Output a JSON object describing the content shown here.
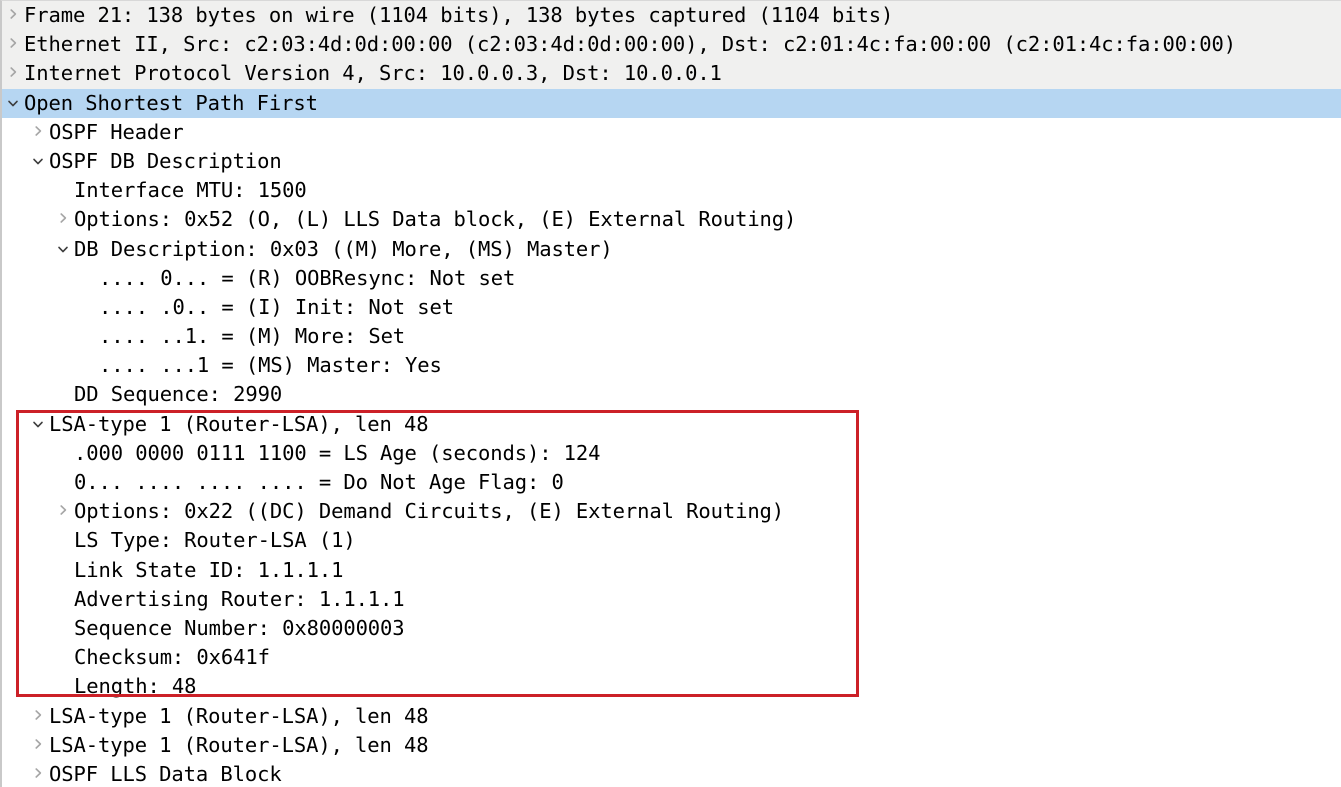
{
  "pane": {
    "name": "wireshark-packet-details",
    "selected_row_index": 3,
    "colors": {
      "selection": "#b6d6f2",
      "shaded_row": "#f0f0ef",
      "annotation_box": "#cc2027",
      "collapsed_arrow": "#a6a6a6",
      "expanded_arrow": "#3c3c3c",
      "text": "#000000"
    }
  },
  "annotation": {
    "shape": "rectangle",
    "color": "#cc2027",
    "covers_rows": [
      12,
      13,
      14,
      15,
      16,
      17,
      18,
      19,
      20,
      21
    ]
  },
  "rows": [
    {
      "text": "Frame 21: 138 bytes on wire (1104 bits), 138 bytes captured (1104 bits)",
      "indent": 0,
      "state": "collapsed",
      "shaded": true,
      "selected": false
    },
    {
      "text": "Ethernet II, Src: c2:03:4d:0d:00:00 (c2:03:4d:0d:00:00), Dst: c2:01:4c:fa:00:00 (c2:01:4c:fa:00:00)",
      "indent": 0,
      "state": "collapsed",
      "shaded": true,
      "selected": false
    },
    {
      "text": "Internet Protocol Version 4, Src: 10.0.0.3, Dst: 10.0.0.1",
      "indent": 0,
      "state": "collapsed",
      "shaded": true,
      "selected": false
    },
    {
      "text": "Open Shortest Path First",
      "indent": 0,
      "state": "expanded",
      "shaded": false,
      "selected": true
    },
    {
      "text": "OSPF Header",
      "indent": 1,
      "state": "collapsed",
      "shaded": false,
      "selected": false
    },
    {
      "text": "OSPF DB Description",
      "indent": 1,
      "state": "expanded",
      "shaded": false,
      "selected": false
    },
    {
      "text": "Interface MTU: 1500",
      "indent": 2,
      "state": "leaf",
      "shaded": false,
      "selected": false
    },
    {
      "text": "Options: 0x52 (O, (L) LLS Data block, (E) External Routing)",
      "indent": 2,
      "state": "collapsed",
      "shaded": false,
      "selected": false
    },
    {
      "text": "DB Description: 0x03 ((M) More, (MS) Master)",
      "indent": 2,
      "state": "expanded",
      "shaded": false,
      "selected": false
    },
    {
      "text": ".... 0... = (R) OOBResync: Not set",
      "indent": 3,
      "state": "leaf",
      "shaded": false,
      "selected": false
    },
    {
      "text": ".... .0.. = (I) Init: Not set",
      "indent": 3,
      "state": "leaf",
      "shaded": false,
      "selected": false
    },
    {
      "text": ".... ..1. = (M) More: Set",
      "indent": 3,
      "state": "leaf",
      "shaded": false,
      "selected": false
    },
    {
      "text": ".... ...1 = (MS) Master: Yes",
      "indent": 3,
      "state": "leaf",
      "shaded": false,
      "selected": false
    },
    {
      "text": "DD Sequence: 2990",
      "indent": 2,
      "state": "leaf",
      "shaded": false,
      "selected": false
    },
    {
      "text": "LSA-type 1 (Router-LSA), len 48",
      "indent": 1,
      "state": "expanded",
      "shaded": false,
      "selected": false
    },
    {
      "text": ".000 0000 0111 1100 = LS Age (seconds): 124",
      "indent": 2,
      "state": "leaf",
      "shaded": false,
      "selected": false
    },
    {
      "text": "0... .... .... .... = Do Not Age Flag: 0",
      "indent": 2,
      "state": "leaf",
      "shaded": false,
      "selected": false
    },
    {
      "text": "Options: 0x22 ((DC) Demand Circuits, (E) External Routing)",
      "indent": 2,
      "state": "collapsed",
      "shaded": false,
      "selected": false
    },
    {
      "text": "LS Type: Router-LSA (1)",
      "indent": 2,
      "state": "leaf",
      "shaded": false,
      "selected": false
    },
    {
      "text": "Link State ID: 1.1.1.1",
      "indent": 2,
      "state": "leaf",
      "shaded": false,
      "selected": false
    },
    {
      "text": "Advertising Router: 1.1.1.1",
      "indent": 2,
      "state": "leaf",
      "shaded": false,
      "selected": false
    },
    {
      "text": "Sequence Number: 0x80000003",
      "indent": 2,
      "state": "leaf",
      "shaded": false,
      "selected": false
    },
    {
      "text": "Checksum: 0x641f",
      "indent": 2,
      "state": "leaf",
      "shaded": false,
      "selected": false
    },
    {
      "text": "Length: 48",
      "indent": 2,
      "state": "leaf",
      "shaded": false,
      "selected": false
    },
    {
      "text": "LSA-type 1 (Router-LSA), len 48",
      "indent": 1,
      "state": "collapsed",
      "shaded": false,
      "selected": false
    },
    {
      "text": "LSA-type 1 (Router-LSA), len 48",
      "indent": 1,
      "state": "collapsed",
      "shaded": false,
      "selected": false
    },
    {
      "text": "OSPF LLS Data Block",
      "indent": 1,
      "state": "collapsed",
      "shaded": false,
      "selected": false
    }
  ]
}
